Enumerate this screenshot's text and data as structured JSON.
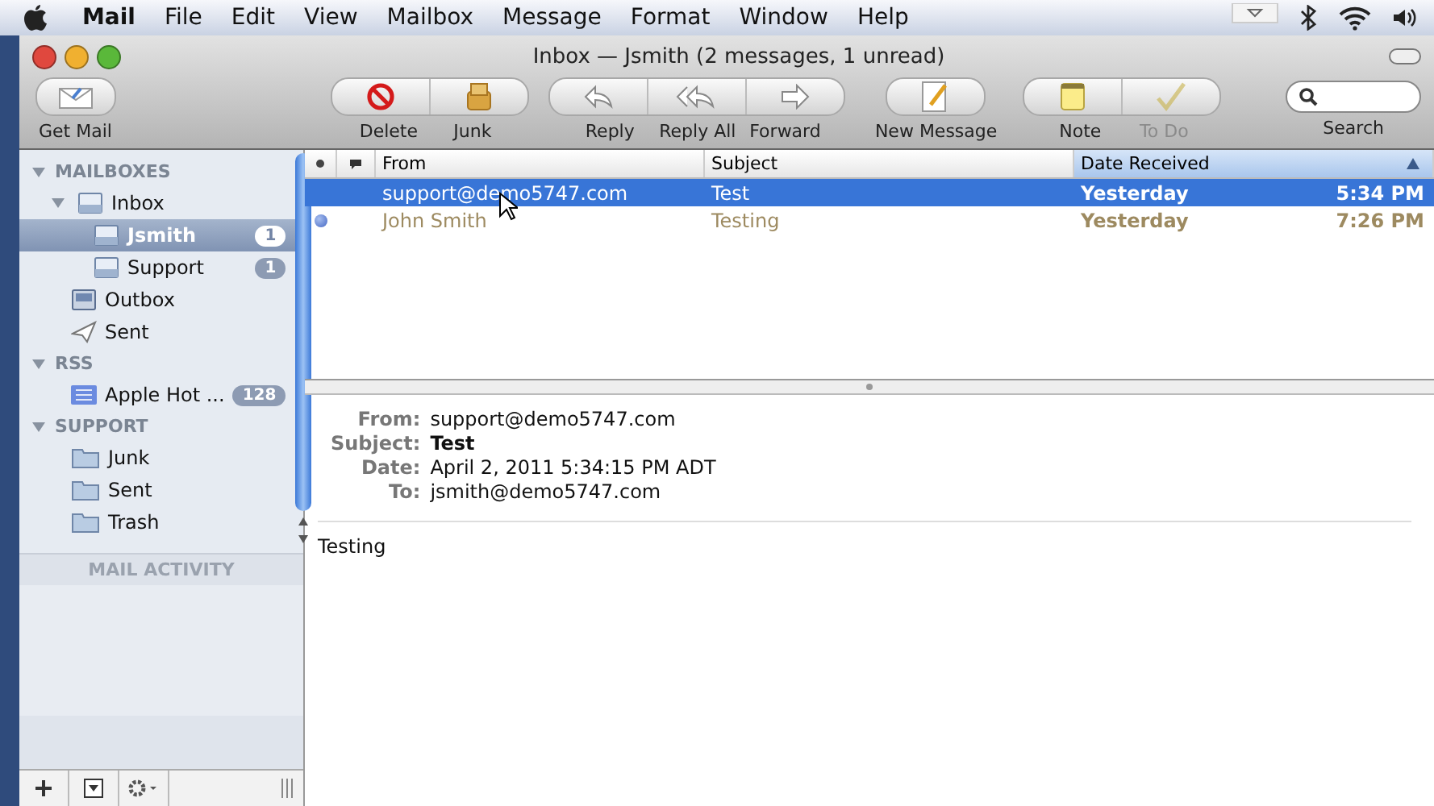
{
  "menu_bar": {
    "app_name": "Mail",
    "items": [
      "File",
      "Edit",
      "View",
      "Mailbox",
      "Message",
      "Format",
      "Window",
      "Help"
    ]
  },
  "window": {
    "title": "Inbox — Jsmith (2 messages, 1 unread)"
  },
  "toolbar": {
    "groups": [
      {
        "items": [
          {
            "kind": "getmail",
            "label": "Get Mail",
            "disabled": false
          }
        ]
      },
      {
        "items": [
          {
            "kind": "delete",
            "label": "Delete",
            "disabled": false
          },
          {
            "kind": "junk",
            "label": "Junk",
            "disabled": false
          }
        ]
      },
      {
        "items": [
          {
            "kind": "reply",
            "label": "Reply",
            "disabled": false
          },
          {
            "kind": "replyall",
            "label": "Reply All",
            "disabled": false
          },
          {
            "kind": "forward",
            "label": "Forward",
            "disabled": false
          }
        ]
      },
      {
        "items": [
          {
            "kind": "newmessage",
            "label": "New Message",
            "disabled": false
          }
        ]
      },
      {
        "items": [
          {
            "kind": "note",
            "label": "Note",
            "disabled": false
          },
          {
            "kind": "todo",
            "label": "To Do",
            "disabled": true
          }
        ]
      }
    ],
    "search": {
      "label": "Search"
    }
  },
  "sidebar": {
    "sections": [
      {
        "title": "MAILBOXES",
        "expanded": true,
        "items": [
          {
            "kind": "inbox",
            "label": "Inbox",
            "expanded": true,
            "selected": false,
            "children": [
              {
                "kind": "inbox",
                "label": "Jsmith",
                "badge": "1",
                "selected": true
              },
              {
                "kind": "inbox",
                "label": "Support",
                "badge": "1",
                "selected": false
              }
            ]
          },
          {
            "kind": "outbox",
            "label": "Outbox",
            "selected": false
          },
          {
            "kind": "sent",
            "label": "Sent",
            "selected": false
          }
        ]
      },
      {
        "title": "RSS",
        "expanded": true,
        "items": [
          {
            "kind": "rss",
            "label": "Apple Hot ...",
            "badge": "128",
            "selected": false
          }
        ]
      },
      {
        "title": "SUPPORT",
        "expanded": true,
        "items": [
          {
            "kind": "folder",
            "label": "Junk",
            "selected": false
          },
          {
            "kind": "folder",
            "label": "Sent",
            "selected": false
          },
          {
            "kind": "folder",
            "label": "Trash",
            "selected": false
          }
        ]
      }
    ],
    "activity_title": "MAIL ACTIVITY"
  },
  "message_list": {
    "columns": [
      {
        "label": "From",
        "sorted": false
      },
      {
        "label": "Subject",
        "sorted": false
      },
      {
        "label": "Date Received",
        "sorted": true
      }
    ],
    "rows": [
      {
        "from": "support@demo5747.com",
        "subject": "Test",
        "date": "Yesterday",
        "time": "5:34 PM",
        "unread": false,
        "selected": true
      },
      {
        "from": "John Smith",
        "subject": "Testing",
        "date": "Yesterday",
        "time": "7:26 PM",
        "unread": true,
        "selected": false
      }
    ]
  },
  "preview": {
    "headers": [
      {
        "label": "From:",
        "value": "support@demo5747.com",
        "bold": false
      },
      {
        "label": "Subject:",
        "value": "Test",
        "bold": true
      },
      {
        "label": "Date:",
        "value": "April 2, 2011 5:34:15 PM ADT",
        "bold": false
      },
      {
        "label": "To:",
        "value": "jsmith@demo5747.com",
        "bold": false
      }
    ],
    "body": "Testing"
  }
}
